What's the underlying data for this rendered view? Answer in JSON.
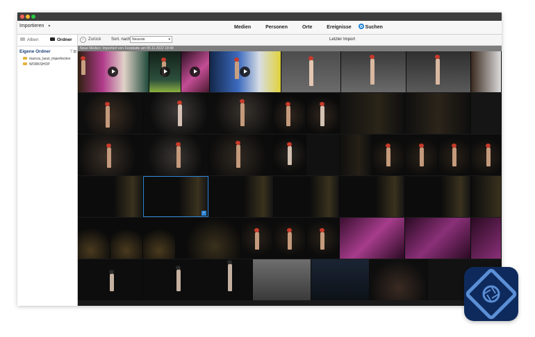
{
  "window": {
    "traffic_lights": [
      "#ff5f57",
      "#febc2e",
      "#28c840"
    ]
  },
  "menubar": {
    "import_label": "Importieren",
    "nav": [
      "Medien",
      "Personen",
      "Orte",
      "Ereignisse"
    ],
    "search_label": "Suchen"
  },
  "sidebar": {
    "tabs": [
      "Alben",
      "Ordner"
    ],
    "folders_title": "Eigene Ordner",
    "folders": [
      "marcos_lanzi_imperfection",
      "WORKSHOP"
    ]
  },
  "toolbar": {
    "back_label": "Zurück",
    "sort_label": "Sort. nach:",
    "sort_value": "Neueste",
    "last_import_label": "Letzter Import"
  },
  "infobar": {
    "text": "Neue Medien: Importiert von Festplatte am 05.11.2022 18:49"
  },
  "grid": {
    "rows": 6,
    "selected": "row 4, thumbnail 2",
    "video_thumbnails": 4
  },
  "colors": {
    "accent": "#2f86d6",
    "logo_bg": "#0e2a5c",
    "logo_ring": "#5b8fd6"
  },
  "icons": [
    "search-icon",
    "back-icon",
    "folder-icon",
    "album-icon",
    "play-icon",
    "check-icon",
    "camera-aperture-icon"
  ]
}
